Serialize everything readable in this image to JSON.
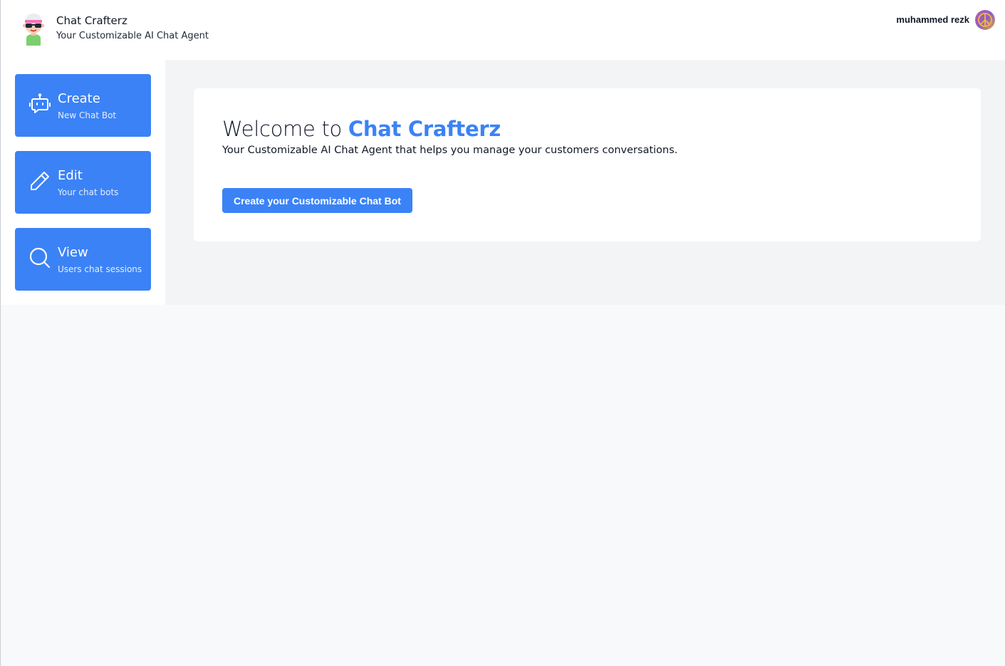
{
  "header": {
    "logo_icon": "robot-character-icon",
    "app_title": "Chat Crafterz",
    "app_subtitle": "Your Customizable AI Chat Agent",
    "user_name": "muhammed rezk",
    "avatar_icon": "peace-symbol-avatar-icon"
  },
  "sidebar": {
    "items": [
      {
        "icon": "robot-icon",
        "title": "Create",
        "subtitle": "New Chat Bot"
      },
      {
        "icon": "pencil-icon",
        "title": "Edit",
        "subtitle": "Your chat bots"
      },
      {
        "icon": "search-icon",
        "title": "View",
        "subtitle": "Users chat sessions"
      }
    ]
  },
  "main": {
    "welcome_prefix": "Welcome to",
    "welcome_brand": "Chat Crafterz",
    "description": "Your Customizable AI Chat Agent that helps you manage your customers conversations.",
    "cta_label": "Create your Customizable Chat Bot"
  },
  "colors": {
    "accent": "#3b82f6",
    "main_background": "#f3f4f6",
    "card_background": "#ffffff"
  }
}
